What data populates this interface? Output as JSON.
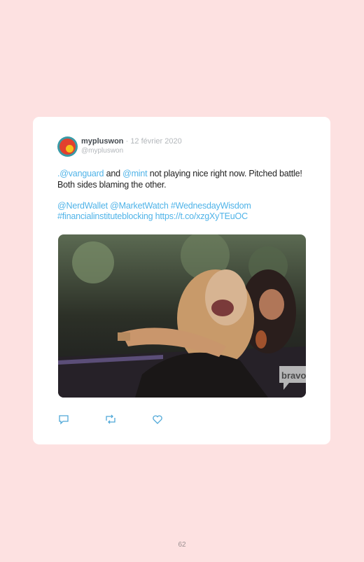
{
  "tweet": {
    "display_name": "mypluswon",
    "separator": "·",
    "date": "12 février 2020",
    "handle": "@mypluswon",
    "line1": [
      {
        "text": ".@vanguard",
        "type": "link"
      },
      {
        "text": " and ",
        "type": "text"
      },
      {
        "text": "@mint",
        "type": "link"
      },
      {
        "text": " not playing nice right now. Pitched battle! Both sides blaming the other.",
        "type": "text"
      }
    ],
    "line2": [
      {
        "text": "@NerdWallet",
        "type": "link"
      },
      {
        "text": " ",
        "type": "text"
      },
      {
        "text": "@MarketWatch",
        "type": "link"
      },
      {
        "text": " ",
        "type": "text"
      },
      {
        "text": "#WednesdayWisdom",
        "type": "link"
      },
      {
        "text": " ",
        "type": "text"
      },
      {
        "text": "#financialinstituteblocking",
        "type": "link"
      },
      {
        "text": " ",
        "type": "text"
      },
      {
        "text": "https://t.co/xzgXyTEuOC",
        "type": "link"
      }
    ],
    "media_watermark": "bravo",
    "actions": [
      {
        "name": "reply-icon"
      },
      {
        "name": "retweet-icon"
      },
      {
        "name": "like-icon"
      }
    ]
  },
  "page": {
    "number": "62"
  },
  "colors": {
    "background": "#fde1e1",
    "link": "#4fb3e8",
    "card": "#ffffff"
  }
}
